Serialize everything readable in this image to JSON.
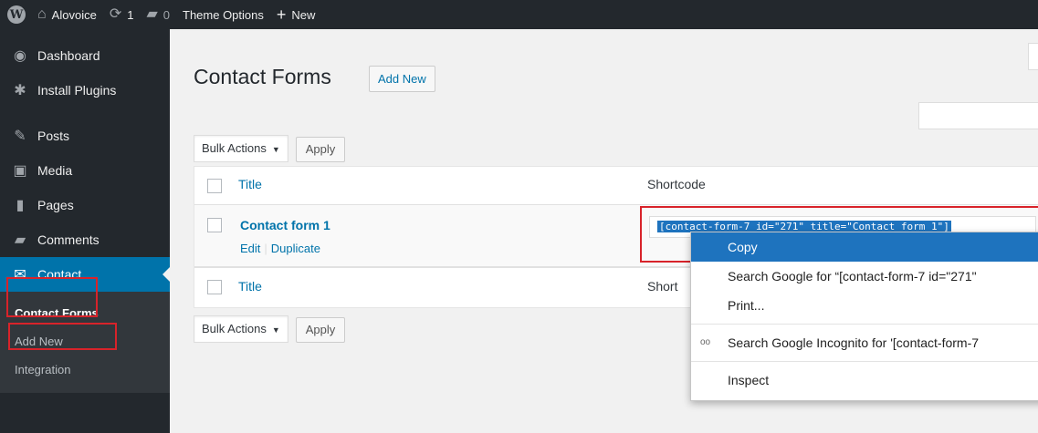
{
  "adminbar": {
    "site": "Alovoice",
    "updates": "1",
    "comments": "0",
    "theme_options": "Theme Options",
    "new": "New"
  },
  "sidebar": {
    "items": [
      {
        "label": "Dashboard",
        "icon": "gauge-icon"
      },
      {
        "label": "Install Plugins",
        "icon": "gear-icon"
      },
      {
        "label": "Posts",
        "icon": "pin-icon"
      },
      {
        "label": "Media",
        "icon": "media-icon"
      },
      {
        "label": "Pages",
        "icon": "page-icon"
      },
      {
        "label": "Comments",
        "icon": "comment-icon"
      },
      {
        "label": "Contact",
        "icon": "envelope-icon"
      }
    ],
    "submenu": [
      "Contact Forms",
      "Add New",
      "Integration"
    ]
  },
  "main": {
    "title": "Contact Forms",
    "add_new": "Add New",
    "bulk_actions": "Bulk Actions",
    "apply": "Apply",
    "columns": {
      "title": "Title",
      "shortcode": "Shortcode"
    },
    "rows": [
      {
        "title": "Contact form 1",
        "actions": [
          "Edit",
          "Duplicate"
        ],
        "shortcode": "[contact-form-7 id=\"271\" title=\"Contact form 1\"]"
      }
    ],
    "footer_shortcode": "Short"
  },
  "context_menu": {
    "items": [
      "Copy",
      "Search Google for “[contact-form-7 id=\"271\"",
      "Print...",
      "Search Google Incognito for '[contact-form-7",
      "Inspect"
    ]
  },
  "colors": {
    "accent": "#0073aa",
    "highlight": "#d8232a",
    "adminbar": "#23282d"
  }
}
